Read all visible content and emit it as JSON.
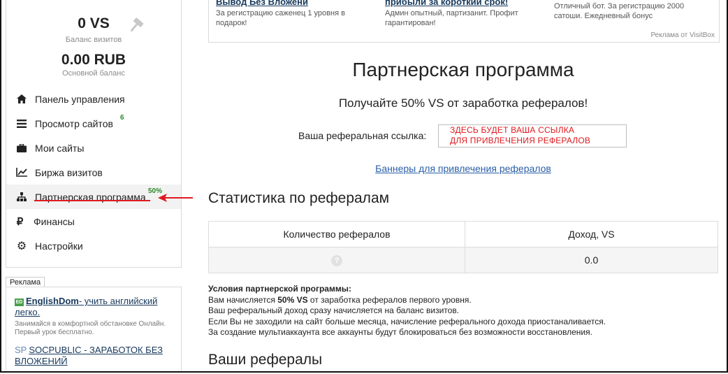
{
  "top_ads": [
    {
      "title": "Вывод Без Вложени",
      "desc": "За регистрацию саженец 1 уровня в подарок!"
    },
    {
      "title": "прибыли за короткий срок!",
      "desc": "Админ опытный, партизанит. Профит гарантирован!"
    },
    {
      "title": "",
      "desc": "Отличный бот. За регистрацию 2000 сатоши. Ежедневный бонус"
    }
  ],
  "top_ads_credit": "Реклама от VisitBox",
  "balance": {
    "vs_value": "0 VS",
    "vs_label": "Баланс визитов",
    "rub_value": "0.00 RUB",
    "rub_label": "Основной баланс"
  },
  "menu": [
    {
      "label": "Панель управления",
      "icon": "home-icon"
    },
    {
      "label": "Просмотр сайтов",
      "icon": "list-icon",
      "badge": "6"
    },
    {
      "label": "Мои сайты",
      "icon": "briefcase-icon"
    },
    {
      "label": "Биржа визитов",
      "icon": "chart-line-icon"
    },
    {
      "label": "Партнерская программа",
      "icon": "sitemap-icon",
      "badge": "50%",
      "active": true
    },
    {
      "label": "Финансы",
      "icon": "ruble-icon"
    },
    {
      "label": "Настройки",
      "icon": "gear-icon"
    }
  ],
  "sidebar_ads": {
    "tab": "Реклама",
    "items": [
      {
        "icon": "ED",
        "title": "EnglishDom",
        "title_rest": "- учить английский легко.",
        "desc": "Занимайся в комфортной обстановке Онлайн. Первый урок бесплатно."
      },
      {
        "icon": "SP",
        "title": "SOCPUBLIC - ЗАРАБОТОК БЕЗ ВЛОЖЕНИЙ",
        "title_rest": "",
        "desc": ""
      }
    ]
  },
  "page": {
    "title": "Партнерская программа",
    "subtitle": "Получайте 50% VS от заработка рефералов!",
    "ref_label": "Ваша реферальная ссылка:",
    "ref_placeholder_line1": "ЗДЕСЬ БУДЕТ ВАША ССЫЛКА",
    "ref_placeholder_line2": "ДЛЯ ПРИВЛЕЧЕНИЯ РЕФЕРАЛОВ",
    "banners_link": "Баннеры для привлечения рефералов",
    "stats_title": "Статистика по рефералам",
    "stats_table": {
      "headers": [
        "Количество рефералов",
        "Доход, VS"
      ],
      "row": [
        "?",
        "0.0"
      ]
    },
    "conditions": {
      "title": "Условия партнерской программы:",
      "line1_pre": "Вам начисляется ",
      "line1_bold": "50% VS",
      "line1_post": " от заработка рефералов первого уровня.",
      "line2": "Ваш реферальный доход сразу начисляется на баланс визитов.",
      "line3": "Если Вы не заходили на сайт больше месяца, начисление реферального дохода приостаналивается.",
      "line4": "За создание мультиаккаунта все аккаунты будут блокироваться без возможности восстановления."
    },
    "referrals_title": "Ваши рефералы"
  },
  "colors": {
    "accent_red": "#e0191f",
    "link_blue": "#2a5fa8",
    "badge_green": "#2a8a2a"
  }
}
